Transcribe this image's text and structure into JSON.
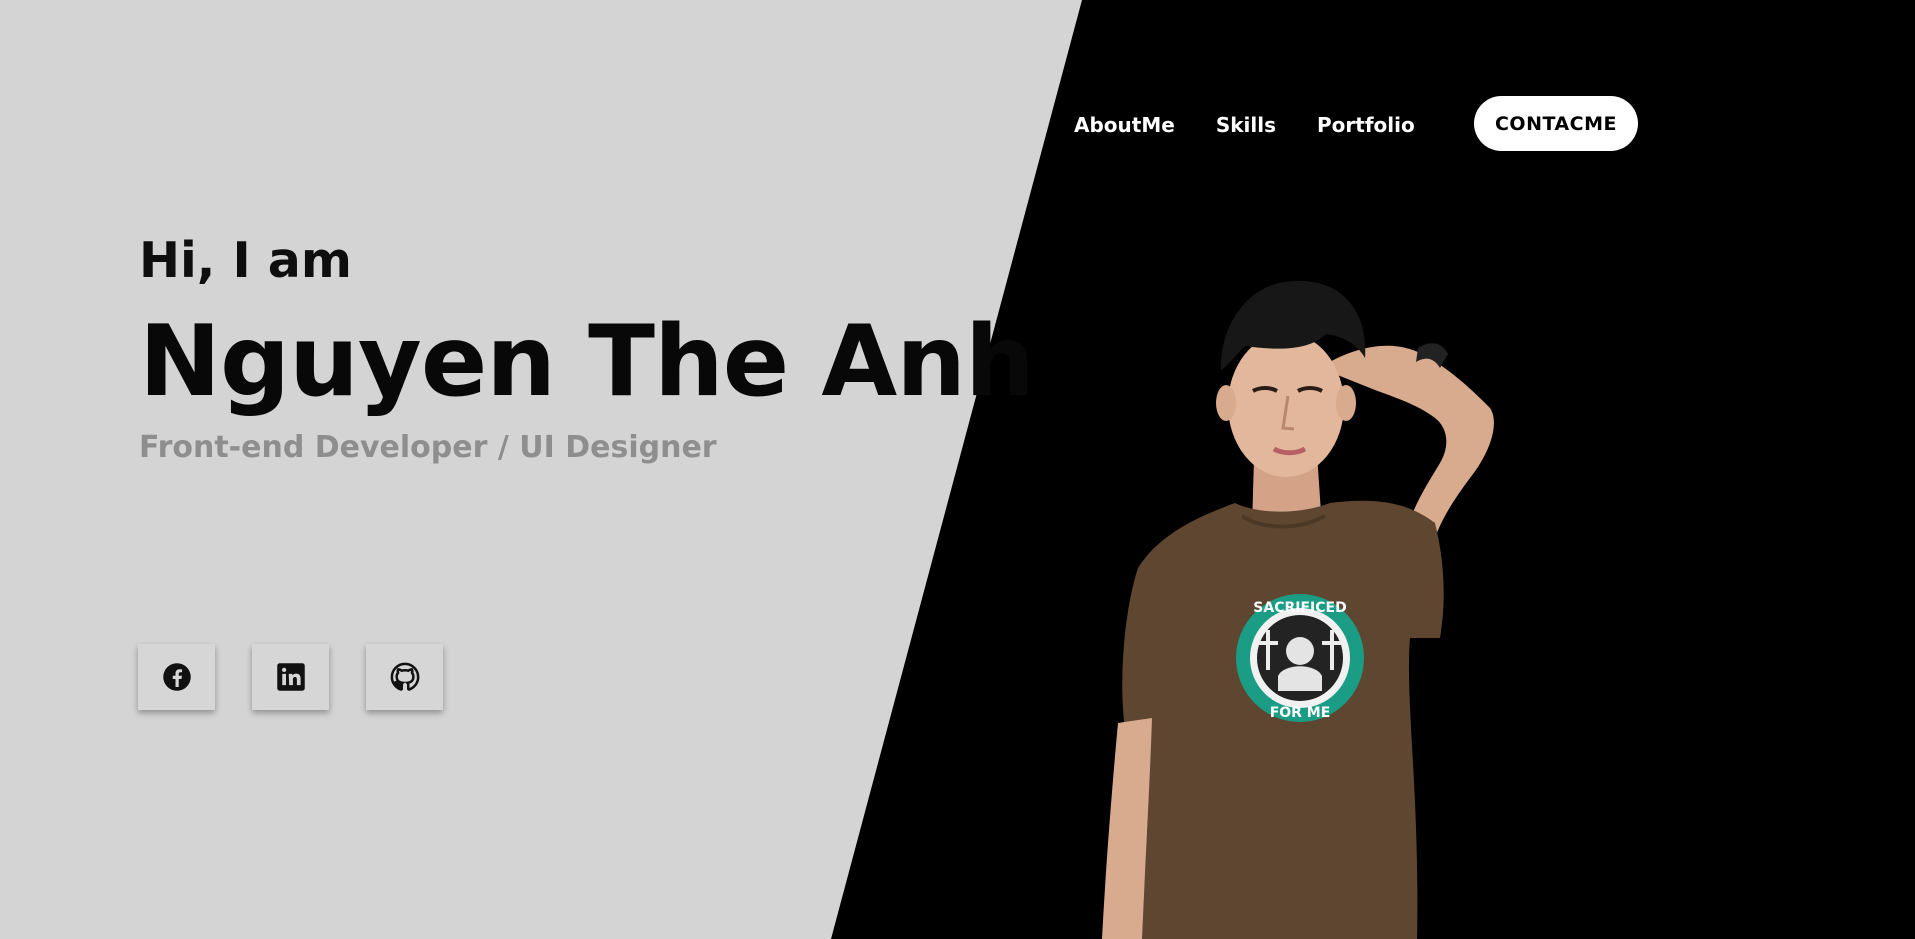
{
  "hero": {
    "greeting": "Hi, I am",
    "name": "Nguyen The Anh",
    "role": "Front-end Developer / UI Designer"
  },
  "nav": {
    "items": [
      {
        "label": "AboutMe"
      },
      {
        "label": "Skills"
      },
      {
        "label": "Portfolio"
      }
    ],
    "contact_label": "CONTACME"
  },
  "socials": [
    {
      "icon": "facebook-icon"
    },
    {
      "icon": "linkedin-icon"
    },
    {
      "icon": "github-icon"
    }
  ],
  "portrait": {
    "shirt_text_top": "SACRIFICED",
    "shirt_text_bottom": "FOR ME"
  },
  "colors": {
    "light_background": "#d4d4d4",
    "dark_background": "#000000",
    "heading_text": "#080808",
    "role_text": "#8e8e8e",
    "contact_button": "#ffffff",
    "shirt": "#5f4631",
    "shirt_logo": "#1a9d84"
  }
}
